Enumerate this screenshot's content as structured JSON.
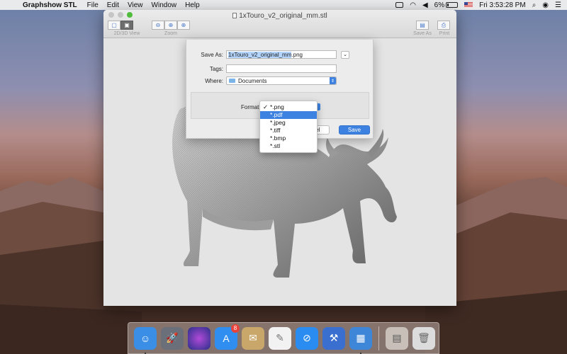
{
  "menubar": {
    "app_name": "Graphshow STL",
    "menus": [
      "File",
      "Edit",
      "View",
      "Window",
      "Help"
    ],
    "battery_percent": "6%",
    "clock": "Fri 3:53:28 PM"
  },
  "window": {
    "title": "1xTouro_v2_original_mm.stl",
    "toolbar": {
      "view_label": "2D/3D View",
      "zoom_label": "Zoom",
      "save_as_label": "Save As",
      "print_label": "Print"
    }
  },
  "save_sheet": {
    "save_as_label": "Save As:",
    "filename": "1xTouro_v2_original_mm",
    "extension": ".png",
    "tags_label": "Tags:",
    "tags_value": "",
    "where_label": "Where:",
    "where_value": "Documents",
    "format_label": "Format",
    "cancel_label": "Cancel",
    "save_label": "Save",
    "format_options": [
      {
        "label": "*.png",
        "checked": true,
        "highlighted": false
      },
      {
        "label": "*.pdf",
        "checked": false,
        "highlighted": true
      },
      {
        "label": "*.jpeg",
        "checked": false,
        "highlighted": false
      },
      {
        "label": "*.tiff",
        "checked": false,
        "highlighted": false
      },
      {
        "label": "*.bmp",
        "checked": false,
        "highlighted": false
      },
      {
        "label": "*.stl",
        "checked": false,
        "highlighted": false
      }
    ]
  },
  "dock": {
    "apps": [
      {
        "icon": "finder-icon",
        "color": "#3a8ee6"
      },
      {
        "icon": "launchpad-icon",
        "color": "#6b6f7a"
      },
      {
        "icon": "siri-icon",
        "color": "#3b2f7a"
      },
      {
        "icon": "app-store-icon",
        "color": "#2f8ef0",
        "badge": "8"
      },
      {
        "icon": "mail-stamp-icon",
        "color": "#c9a76a"
      },
      {
        "icon": "textedit-icon",
        "color": "#f2f2f2"
      },
      {
        "icon": "safari-icon",
        "color": "#2a8bf0"
      },
      {
        "icon": "xcode-icon",
        "color": "#3a6fd0"
      },
      {
        "icon": "graphshow-stl-icon",
        "color": "#3d86d8"
      }
    ],
    "right": [
      {
        "icon": "downloads-stack-icon",
        "color": "#c8c0b8"
      },
      {
        "icon": "trash-icon",
        "color": "#dcdcdc"
      }
    ]
  }
}
